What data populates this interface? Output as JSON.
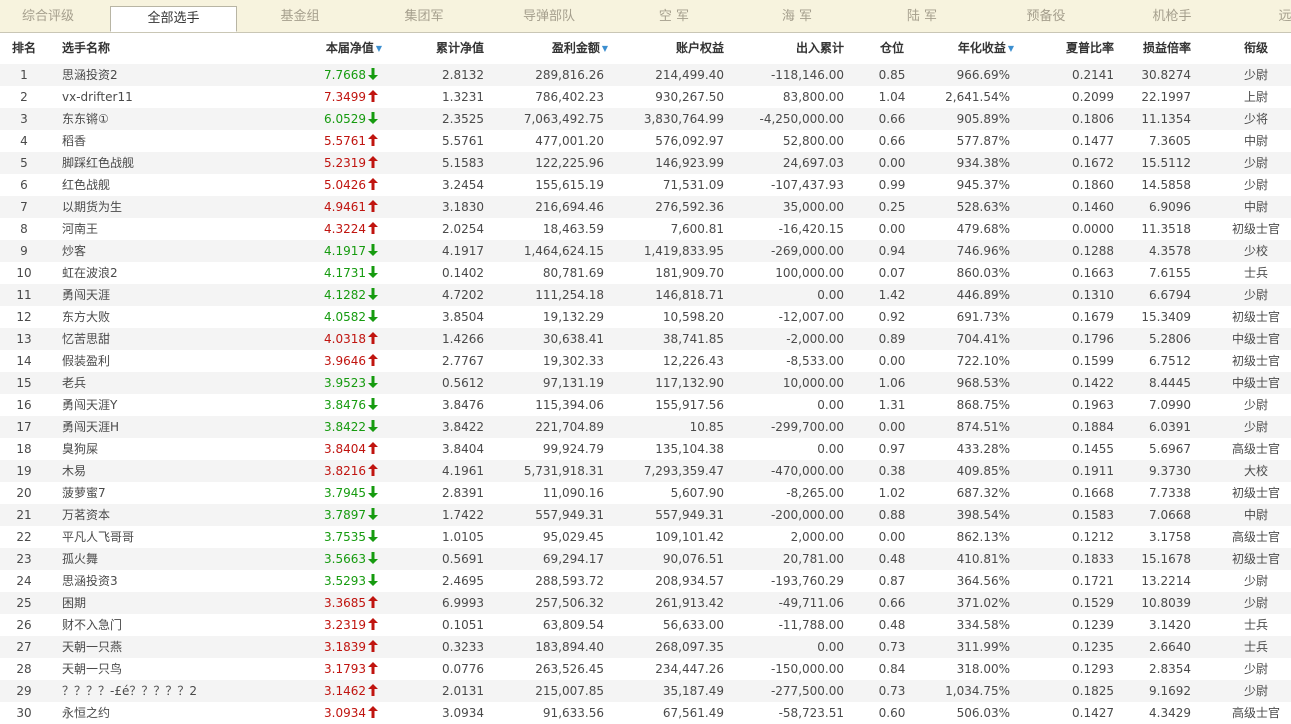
{
  "tabs": [
    {
      "label": "综合评级",
      "active": false
    },
    {
      "label": "全部选手",
      "active": true
    },
    {
      "label": "基金组",
      "active": false
    },
    {
      "label": "集团军",
      "active": false
    },
    {
      "label": "导弹部队",
      "active": false
    },
    {
      "label": "空 军",
      "active": false
    },
    {
      "label": "海 军",
      "active": false
    },
    {
      "label": "陆 军",
      "active": false
    },
    {
      "label": "预备役",
      "active": false
    },
    {
      "label": "机枪手",
      "active": false
    },
    {
      "label": "远",
      "active": false
    }
  ],
  "columns": [
    {
      "label": "排名"
    },
    {
      "label": "选手名称"
    },
    {
      "label": "本届净值",
      "sort_icon": "sort-desc-icon"
    },
    {
      "label": "累计净值"
    },
    {
      "label": "盈利金额",
      "sort_icon": "sort-desc-icon"
    },
    {
      "label": "账户权益"
    },
    {
      "label": "出入累计"
    },
    {
      "label": "仓位"
    },
    {
      "label": "年化收益",
      "sort_icon": "sort-desc-icon"
    },
    {
      "label": "夏普比率"
    },
    {
      "label": "损益倍率"
    },
    {
      "label": "衔级"
    }
  ],
  "colors": {
    "up": "#c0140f",
    "down": "#169b0f",
    "tab_bar_bg": "#f7f3de",
    "row_alt_bg": "#f4f4f4",
    "sort_icon": "#3c8fd0"
  },
  "rows": [
    {
      "rank": "1",
      "name": "思涵投资2",
      "nav": "7.7668",
      "dir": "down",
      "cum": "2.8132",
      "profit": "289,816.26",
      "equity": "214,499.40",
      "flow": "-118,146.00",
      "pos": "0.85",
      "annual": "966.69%",
      "sharpe": "0.2141",
      "pl": "30.8274",
      "grade": "少尉"
    },
    {
      "rank": "2",
      "name": "vx-drifter11",
      "nav": "7.3499",
      "dir": "up",
      "cum": "1.3231",
      "profit": "786,402.23",
      "equity": "930,267.50",
      "flow": "83,800.00",
      "pos": "1.04",
      "annual": "2,641.54%",
      "sharpe": "0.2099",
      "pl": "22.1997",
      "grade": "上尉"
    },
    {
      "rank": "3",
      "name": "东东锵①",
      "nav": "6.0529",
      "dir": "down",
      "cum": "2.3525",
      "profit": "7,063,492.75",
      "equity": "3,830,764.99",
      "flow": "-4,250,000.00",
      "pos": "0.66",
      "annual": "905.89%",
      "sharpe": "0.1806",
      "pl": "11.1354",
      "grade": "少将"
    },
    {
      "rank": "4",
      "name": "稻香",
      "nav": "5.5761",
      "dir": "up",
      "cum": "5.5761",
      "profit": "477,001.20",
      "equity": "576,092.97",
      "flow": "52,800.00",
      "pos": "0.66",
      "annual": "577.87%",
      "sharpe": "0.1477",
      "pl": "7.3605",
      "grade": "中尉"
    },
    {
      "rank": "5",
      "name": "脚踩红色战舰",
      "nav": "5.2319",
      "dir": "up",
      "cum": "5.1583",
      "profit": "122,225.96",
      "equity": "146,923.99",
      "flow": "24,697.03",
      "pos": "0.00",
      "annual": "934.38%",
      "sharpe": "0.1672",
      "pl": "15.5112",
      "grade": "少尉"
    },
    {
      "rank": "6",
      "name": "红色战舰",
      "nav": "5.0426",
      "dir": "up",
      "cum": "3.2454",
      "profit": "155,615.19",
      "equity": "71,531.09",
      "flow": "-107,437.93",
      "pos": "0.99",
      "annual": "945.37%",
      "sharpe": "0.1860",
      "pl": "14.5858",
      "grade": "少尉"
    },
    {
      "rank": "7",
      "name": "以期货为生",
      "nav": "4.9461",
      "dir": "up",
      "cum": "3.1830",
      "profit": "216,694.46",
      "equity": "276,592.36",
      "flow": "35,000.00",
      "pos": "0.25",
      "annual": "528.63%",
      "sharpe": "0.1460",
      "pl": "6.9096",
      "grade": "中尉"
    },
    {
      "rank": "8",
      "name": "河南王",
      "nav": "4.3224",
      "dir": "up",
      "cum": "2.0254",
      "profit": "18,463.59",
      "equity": "7,600.81",
      "flow": "-16,420.15",
      "pos": "0.00",
      "annual": "479.68%",
      "sharpe": "0.0000",
      "pl": "11.3518",
      "grade": "初级士官"
    },
    {
      "rank": "9",
      "name": "炒客",
      "nav": "4.1917",
      "dir": "down",
      "cum": "4.1917",
      "profit": "1,464,624.15",
      "equity": "1,419,833.95",
      "flow": "-269,000.00",
      "pos": "0.94",
      "annual": "746.96%",
      "sharpe": "0.1288",
      "pl": "4.3578",
      "grade": "少校"
    },
    {
      "rank": "10",
      "name": "虹在波浪2",
      "nav": "4.1731",
      "dir": "down",
      "cum": "0.1402",
      "profit": "80,781.69",
      "equity": "181,909.70",
      "flow": "100,000.00",
      "pos": "0.07",
      "annual": "860.03%",
      "sharpe": "0.1663",
      "pl": "7.6155",
      "grade": "士兵"
    },
    {
      "rank": "11",
      "name": "勇闯天涯",
      "nav": "4.1282",
      "dir": "down",
      "cum": "4.7202",
      "profit": "111,254.18",
      "equity": "146,818.71",
      "flow": "0.00",
      "pos": "1.42",
      "annual": "446.89%",
      "sharpe": "0.1310",
      "pl": "6.6794",
      "grade": "少尉"
    },
    {
      "rank": "12",
      "name": "东方大败",
      "nav": "4.0582",
      "dir": "down",
      "cum": "3.8504",
      "profit": "19,132.29",
      "equity": "10,598.20",
      "flow": "-12,007.00",
      "pos": "0.92",
      "annual": "691.73%",
      "sharpe": "0.1679",
      "pl": "15.3409",
      "grade": "初级士官"
    },
    {
      "rank": "13",
      "name": "忆苦思甜",
      "nav": "4.0318",
      "dir": "up",
      "cum": "1.4266",
      "profit": "30,638.41",
      "equity": "38,741.85",
      "flow": "-2,000.00",
      "pos": "0.89",
      "annual": "704.41%",
      "sharpe": "0.1796",
      "pl": "5.2806",
      "grade": "中级士官"
    },
    {
      "rank": "14",
      "name": "假装盈利",
      "nav": "3.9646",
      "dir": "up",
      "cum": "2.7767",
      "profit": "19,302.33",
      "equity": "12,226.43",
      "flow": "-8,533.00",
      "pos": "0.00",
      "annual": "722.10%",
      "sharpe": "0.1599",
      "pl": "6.7512",
      "grade": "初级士官"
    },
    {
      "rank": "15",
      "name": "老兵",
      "nav": "3.9523",
      "dir": "down",
      "cum": "0.5612",
      "profit": "97,131.19",
      "equity": "117,132.90",
      "flow": "10,000.00",
      "pos": "1.06",
      "annual": "968.53%",
      "sharpe": "0.1422",
      "pl": "8.4445",
      "grade": "中级士官"
    },
    {
      "rank": "16",
      "name": "勇闯天涯Y",
      "nav": "3.8476",
      "dir": "down",
      "cum": "3.8476",
      "profit": "115,394.06",
      "equity": "155,917.56",
      "flow": "0.00",
      "pos": "1.31",
      "annual": "868.75%",
      "sharpe": "0.1963",
      "pl": "7.0990",
      "grade": "少尉"
    },
    {
      "rank": "17",
      "name": "勇闯天涯H",
      "nav": "3.8422",
      "dir": "down",
      "cum": "3.8422",
      "profit": "221,704.89",
      "equity": "10.85",
      "flow": "-299,700.00",
      "pos": "0.00",
      "annual": "874.51%",
      "sharpe": "0.1884",
      "pl": "6.0391",
      "grade": "少尉"
    },
    {
      "rank": "18",
      "name": "臭狗屎",
      "nav": "3.8404",
      "dir": "up",
      "cum": "3.8404",
      "profit": "99,924.79",
      "equity": "135,104.38",
      "flow": "0.00",
      "pos": "0.97",
      "annual": "433.28%",
      "sharpe": "0.1455",
      "pl": "5.6967",
      "grade": "高级士官"
    },
    {
      "rank": "19",
      "name": "木易",
      "nav": "3.8216",
      "dir": "up",
      "cum": "4.1961",
      "profit": "5,731,918.31",
      "equity": "7,293,359.47",
      "flow": "-470,000.00",
      "pos": "0.38",
      "annual": "409.85%",
      "sharpe": "0.1911",
      "pl": "9.3730",
      "grade": "大校"
    },
    {
      "rank": "20",
      "name": "菠萝蜜7",
      "nav": "3.7945",
      "dir": "down",
      "cum": "2.8391",
      "profit": "11,090.16",
      "equity": "5,607.90",
      "flow": "-8,265.00",
      "pos": "1.02",
      "annual": "687.32%",
      "sharpe": "0.1668",
      "pl": "7.7338",
      "grade": "初级士官"
    },
    {
      "rank": "21",
      "name": "万茗资本",
      "nav": "3.7897",
      "dir": "down",
      "cum": "1.7422",
      "profit": "557,949.31",
      "equity": "557,949.31",
      "flow": "-200,000.00",
      "pos": "0.88",
      "annual": "398.54%",
      "sharpe": "0.1583",
      "pl": "7.0668",
      "grade": "中尉"
    },
    {
      "rank": "22",
      "name": "平凡人飞哥哥",
      "nav": "3.7535",
      "dir": "down",
      "cum": "1.0105",
      "profit": "95,029.45",
      "equity": "109,101.42",
      "flow": "2,000.00",
      "pos": "0.00",
      "annual": "862.13%",
      "sharpe": "0.1212",
      "pl": "3.1758",
      "grade": "高级士官"
    },
    {
      "rank": "23",
      "name": "孤火舞",
      "nav": "3.5663",
      "dir": "down",
      "cum": "0.5691",
      "profit": "69,294.17",
      "equity": "90,076.51",
      "flow": "20,781.00",
      "pos": "0.48",
      "annual": "410.81%",
      "sharpe": "0.1833",
      "pl": "15.1678",
      "grade": "初级士官"
    },
    {
      "rank": "24",
      "name": "思涵投资3",
      "nav": "3.5293",
      "dir": "down",
      "cum": "2.4695",
      "profit": "288,593.72",
      "equity": "208,934.57",
      "flow": "-193,760.29",
      "pos": "0.87",
      "annual": "364.56%",
      "sharpe": "0.1721",
      "pl": "13.2214",
      "grade": "少尉"
    },
    {
      "rank": "25",
      "name": "困期",
      "nav": "3.3685",
      "dir": "up",
      "cum": "6.9993",
      "profit": "257,506.32",
      "equity": "261,913.42",
      "flow": "-49,711.06",
      "pos": "0.66",
      "annual": "371.02%",
      "sharpe": "0.1529",
      "pl": "10.8039",
      "grade": "少尉"
    },
    {
      "rank": "26",
      "name": "财不入急门",
      "nav": "3.2319",
      "dir": "up",
      "cum": "0.1051",
      "profit": "63,809.54",
      "equity": "56,633.00",
      "flow": "-11,788.00",
      "pos": "0.48",
      "annual": "334.58%",
      "sharpe": "0.1239",
      "pl": "3.1420",
      "grade": "士兵"
    },
    {
      "rank": "27",
      "name": "天朝一只燕",
      "nav": "3.1839",
      "dir": "up",
      "cum": "0.3233",
      "profit": "183,894.40",
      "equity": "268,097.35",
      "flow": "0.00",
      "pos": "0.73",
      "annual": "311.99%",
      "sharpe": "0.1235",
      "pl": "2.6640",
      "grade": "士兵"
    },
    {
      "rank": "28",
      "name": "天朝一只鸟",
      "nav": "3.1793",
      "dir": "up",
      "cum": "0.0776",
      "profit": "263,526.45",
      "equity": "234,447.26",
      "flow": "-150,000.00",
      "pos": "0.84",
      "annual": "318.00%",
      "sharpe": "0.1293",
      "pl": "2.8354",
      "grade": "少尉"
    },
    {
      "rank": "29",
      "name": "？？？？-£é？？？？？2",
      "nav": "3.1462",
      "dir": "up",
      "cum": "2.0131",
      "profit": "215,007.85",
      "equity": "35,187.49",
      "flow": "-277,500.00",
      "pos": "0.73",
      "annual": "1,034.75%",
      "sharpe": "0.1825",
      "pl": "9.1692",
      "grade": "少尉"
    },
    {
      "rank": "30",
      "name": "永恒之约",
      "nav": "3.0934",
      "dir": "up",
      "cum": "3.0934",
      "profit": "91,633.56",
      "equity": "67,561.49",
      "flow": "-58,723.51",
      "pos": "0.60",
      "annual": "506.03%",
      "sharpe": "0.1427",
      "pl": "4.3429",
      "grade": "高级士官"
    }
  ]
}
